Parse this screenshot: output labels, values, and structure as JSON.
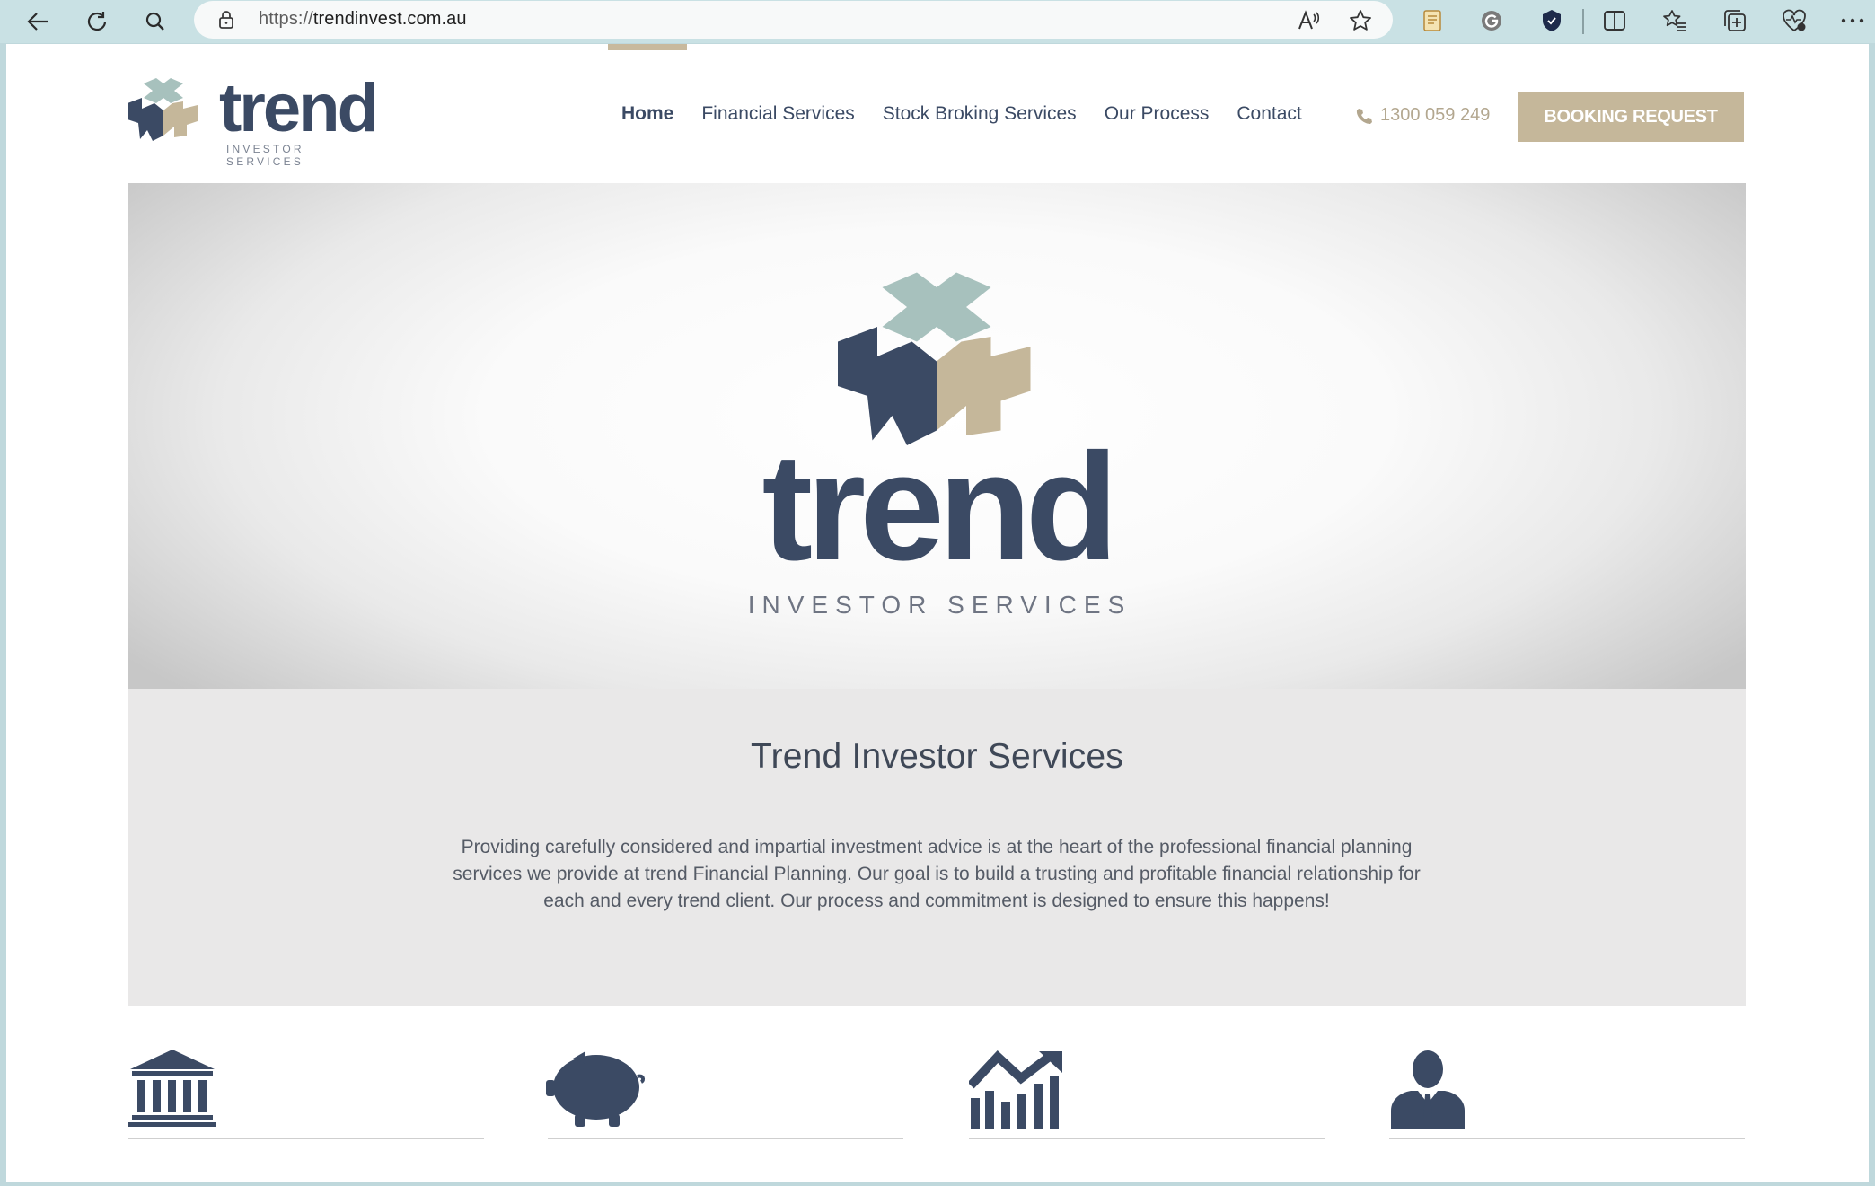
{
  "browser": {
    "url_protocol": "https://",
    "url_host": "trendinvest.com.au",
    "read_aloud_label": "A",
    "read_aloud_sup": "ᵎ"
  },
  "site": {
    "logo_word": "trend",
    "logo_sub": "INVESTOR SERVICES",
    "nav": [
      {
        "label": "Home",
        "active": true
      },
      {
        "label": "Financial Services",
        "active": false
      },
      {
        "label": "Stock Broking Services",
        "active": false
      },
      {
        "label": "Our Process",
        "active": false
      },
      {
        "label": "Contact",
        "active": false
      }
    ],
    "phone": "1300 059 249",
    "booking_label": "BOOKING REQUEST"
  },
  "hero": {
    "logo_word": "trend",
    "logo_sub": "INVESTOR SERVICES"
  },
  "intro": {
    "title": "Trend Investor Services",
    "text": "Providing carefully considered and impartial investment advice is at the heart of the professional financial planning services we provide at trend Financial Planning.  Our goal is to build a trusting and profitable financial relationship for each and every trend client. Our process and commitment is designed to ensure this happens!"
  },
  "features": [
    {
      "icon": "bank-icon"
    },
    {
      "icon": "piggy-bank-icon"
    },
    {
      "icon": "growth-chart-icon"
    },
    {
      "icon": "businessman-icon"
    }
  ],
  "colors": {
    "navy": "#3b4a64",
    "teal": "#a7c1bd",
    "tan": "#c5b79a",
    "intro_bg": "#e9e8e8"
  }
}
